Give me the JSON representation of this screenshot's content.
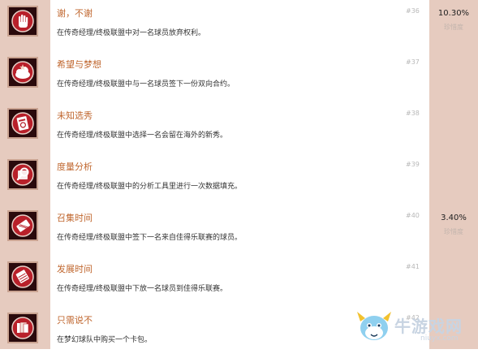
{
  "achievements": [
    {
      "title": "谢，不谢",
      "description": "在传奇经理/终极联盟中对一名球员放弃权利。",
      "number": "#36",
      "percent": "10.30%",
      "rarity": "珍惜度",
      "icon": "hand-stop-icon"
    },
    {
      "title": "希望与梦想",
      "description": "在传奇经理/终极联盟中与一名球员签下一份双向合约。",
      "number": "#37",
      "percent": "",
      "rarity": "",
      "icon": "cloud-star-icon"
    },
    {
      "title": "未知选秀",
      "description": "在传奇经理/终极联盟中选择一名会留在海外的新秀。",
      "number": "#38",
      "percent": "",
      "rarity": "",
      "icon": "passport-icon"
    },
    {
      "title": "度量分析",
      "description": "在传奇经理/终极联盟中的分析工具里进行一次数据填充。",
      "number": "#39",
      "percent": "",
      "rarity": "",
      "icon": "magnifier-icon"
    },
    {
      "title": "召集时间",
      "description": "在传奇经理/终极联盟中签下一名来自佳得乐联赛的球员。",
      "number": "#40",
      "percent": "3.40%",
      "rarity": "珍惜度",
      "icon": "ticket-icon"
    },
    {
      "title": "发展时间",
      "description": "在传奇经理/终极联盟中下放一名球员到佳得乐联赛。",
      "number": "#41",
      "percent": "",
      "rarity": "",
      "icon": "arrow-down-icon"
    },
    {
      "title": "只需说不",
      "description": "在梦幻球队中购买一个卡包。",
      "number": "#42",
      "percent": "",
      "rarity": "",
      "icon": "card-pack-icon"
    }
  ],
  "watermark": {
    "text": "牛游戏网",
    "url": "niuyx.com"
  }
}
